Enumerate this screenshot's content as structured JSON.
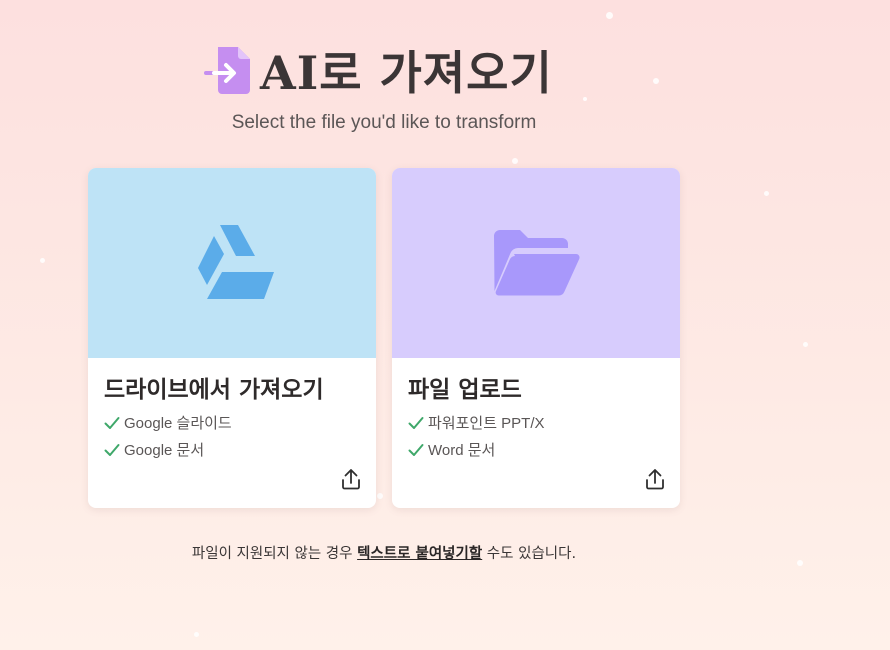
{
  "header": {
    "title": "AI로 가져오기",
    "subtitle": "Select the file you'd like to transform",
    "title_icon": "file-import-icon"
  },
  "cards": [
    {
      "title": "드라이브에서 가져오기",
      "icon": "google-drive-icon",
      "top_color": "#bee3f6",
      "features": [
        "Google 슬라이드",
        "Google 문서"
      ],
      "action_icon": "upload-icon"
    },
    {
      "title": "파일 업로드",
      "icon": "folder-open-icon",
      "top_color": "#d7ccfd",
      "features": [
        "파워포인트 PPT/X",
        "Word 문서"
      ],
      "action_icon": "upload-icon"
    }
  ],
  "footer": {
    "prefix": "파일이 지원되지 않는 경우 ",
    "link": "텍스트로 붙여넣기할",
    "suffix": " 수도 있습니다."
  },
  "colors": {
    "check": "#3fa86a",
    "drive_icon": "#5bace9",
    "folder_icon": "#a898fb",
    "title_icon": "#c58ef0"
  }
}
